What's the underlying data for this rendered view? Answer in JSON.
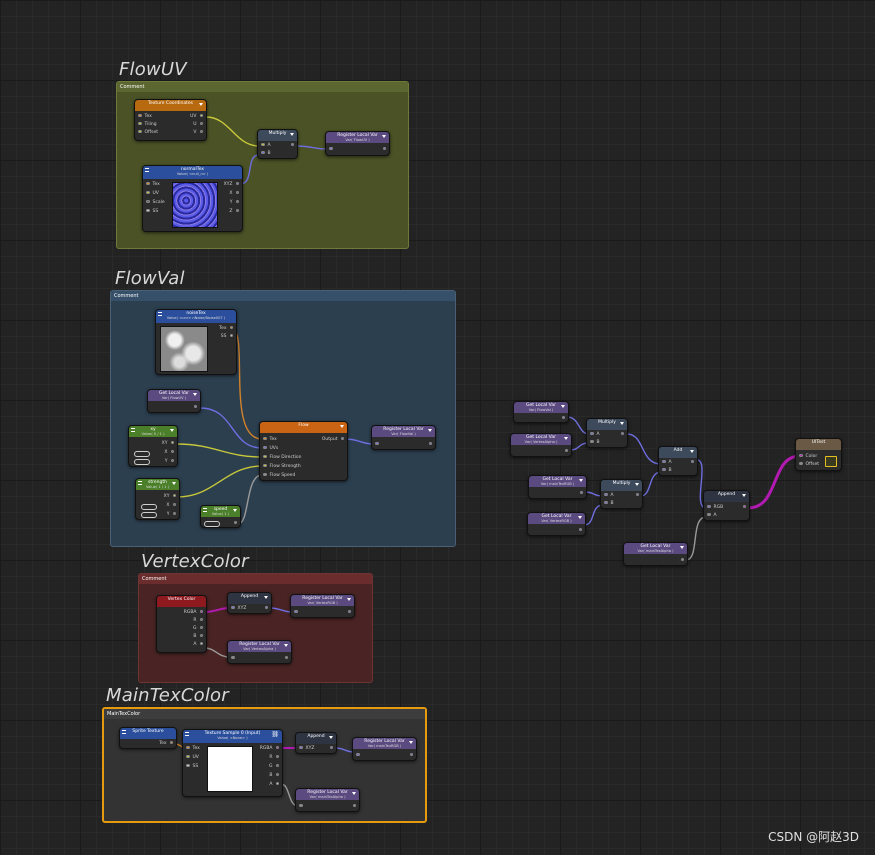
{
  "groups": {
    "flowuv": {
      "title": "FlowUV",
      "header": "Comment",
      "color": "#4a5226"
    },
    "flowval": {
      "title": "FlowVal",
      "header": "Comment",
      "color": "#2c3f4f"
    },
    "vertexcolor": {
      "title": "VertexColor",
      "header": "Comment",
      "color": "#4a2424"
    },
    "maintexcolor": {
      "title": "MainTexColor",
      "header": "MainTexColor",
      "color": "#333333"
    }
  },
  "nodes": {
    "texcoords": {
      "title": "Texture Coordinates",
      "inputs": [
        "Tex",
        "Tiling",
        "Offset"
      ],
      "outputs": [
        "UV",
        "U",
        "V"
      ]
    },
    "multiply_uv": {
      "title": "Multiply",
      "inputs": [
        "A",
        "B"
      ]
    },
    "register_flowuv": {
      "title": "Register Local Var",
      "sub": "Var( FlowUV )"
    },
    "normaltex": {
      "title": "normalTex",
      "sub": "Value( <null_n> )",
      "inputs": [
        "Tex",
        "UV",
        "Scale",
        "SS"
      ],
      "outputs": [
        "XYZ",
        "X",
        "Y",
        "Z"
      ]
    },
    "noisetex": {
      "title": "noiseTex",
      "sub": "Value( <unr> nNoise/Noise007 )",
      "outputs": [
        "Tex",
        "SS"
      ]
    },
    "get_flowuv": {
      "title": "Get Local Var",
      "sub": "Var( FlowUV )"
    },
    "xy_param": {
      "title": "xy",
      "sub": "Value( 0 / 1 )",
      "outputs": [
        "XY",
        "X",
        "Y"
      ]
    },
    "flow": {
      "title": "Flow",
      "inputs": [
        "Tex",
        "UVs",
        "Flow Direction",
        "Flow Strength",
        "Flow Speed"
      ],
      "outputs": [
        "Output"
      ]
    },
    "register_flowval": {
      "title": "Register Local Var",
      "sub": "Var( FlowVal )"
    },
    "strength_param": {
      "title": "strength",
      "sub": "Value( 1 / 1 )",
      "outputs": [
        "XY",
        "X",
        "Y"
      ]
    },
    "speed_param": {
      "title": "speed",
      "sub": "Value( 1 )"
    },
    "vertexcolor": {
      "title": "Vertex Color",
      "outputs": [
        "RGBA",
        "R",
        "G",
        "B",
        "A"
      ]
    },
    "append_vc": {
      "title": "Append",
      "inputs": [
        "XYZ"
      ]
    },
    "register_vertexrgb": {
      "title": "Register Local Var",
      "sub": "Var( VertexRGB )"
    },
    "register_vertexalpha": {
      "title": "Register Local Var",
      "sub": "Var( VertexAlpha )"
    },
    "sprite_texture": {
      "title": "Sprite Texture",
      "outputs": [
        "Tex"
      ]
    },
    "texsample": {
      "title": "Texture Sample 0 (Input)",
      "sub": "Value( <None> )",
      "inputs": [
        "Tex",
        "UV",
        "SS"
      ],
      "outputs": [
        "RGBA",
        "R",
        "G",
        "B",
        "A"
      ]
    },
    "append_main": {
      "title": "Append",
      "inputs": [
        "XYZ"
      ]
    },
    "register_maintexrgb": {
      "title": "Register Local Var",
      "sub": "Var( mainTexRGB )"
    },
    "register_maintexalpha": {
      "title": "Register Local Var",
      "sub": "Var( mainTexAlpha )"
    },
    "get_flowval": {
      "title": "Get Local Var",
      "sub": "Var( FlowVal )"
    },
    "get_vertexalpha": {
      "title": "Get Local Var",
      "sub": "Var( VertexAlpha )"
    },
    "multiply_a": {
      "title": "Multiply",
      "inputs": [
        "A",
        "B"
      ]
    },
    "get_maintexrgb": {
      "title": "Get Local Var",
      "sub": "Var( mainTexRGB )"
    },
    "get_vertexrgb": {
      "title": "Get Local Var",
      "sub": "Var( VertexRGB )"
    },
    "multiply_b": {
      "title": "Multiply",
      "inputs": [
        "A",
        "B"
      ]
    },
    "add": {
      "title": "Add",
      "inputs": [
        "A",
        "B"
      ]
    },
    "append_final": {
      "title": "Append",
      "inputs": [
        "RGB",
        "A"
      ]
    },
    "get_maintexalpha": {
      "title": "Get Local Var",
      "sub": "Var( mainTexAlpha )"
    },
    "uitest": {
      "title": "UITest",
      "inputs": [
        "Color",
        "Offset"
      ]
    }
  },
  "colors": {
    "wire_yellow": "#c8c83a",
    "wire_blue": "#6e6ee0",
    "wire_magenta": "#b21ab2",
    "wire_orange": "#d2822a",
    "wire_grey": "#9a9a9a",
    "highlight": "#e69a10"
  },
  "watermark": "CSDN @阿赵3D"
}
